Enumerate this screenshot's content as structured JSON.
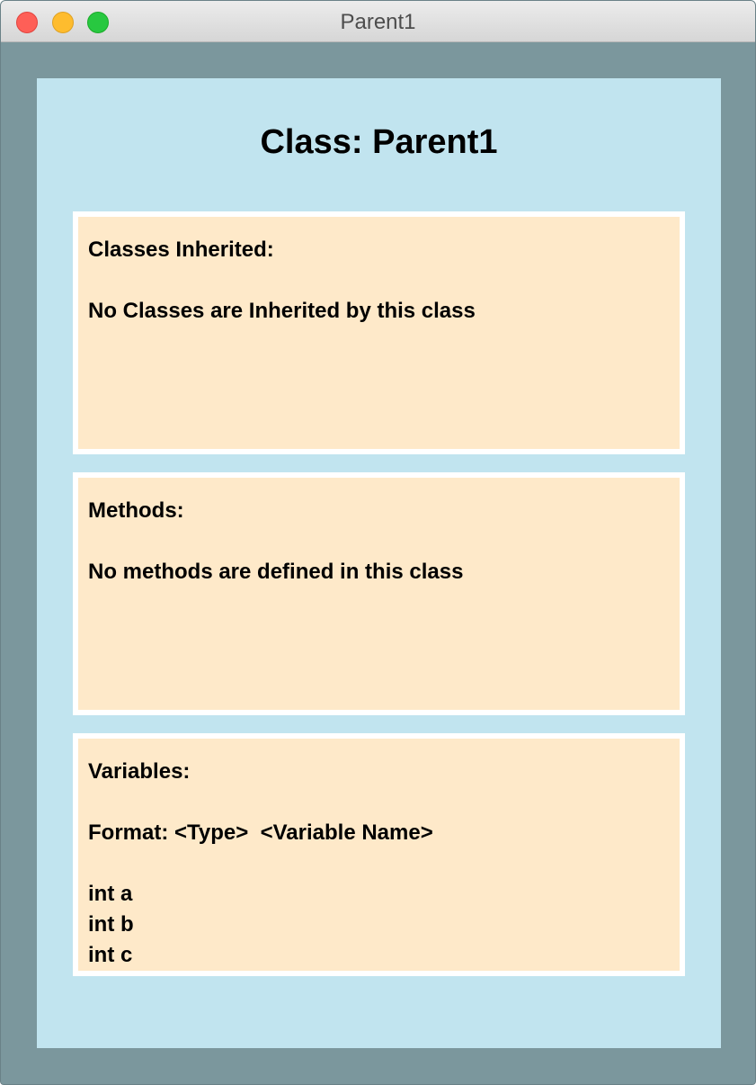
{
  "window": {
    "title": "Parent1"
  },
  "main": {
    "heading": "Class: Parent1",
    "inherited": {
      "label": "Classes Inherited:",
      "text": "No Classes are Inherited by this class"
    },
    "methods": {
      "label": "Methods:",
      "text": "No methods are defined in this class"
    },
    "variables": {
      "label": "Variables:",
      "format": "Format: <Type>  <Variable Name>",
      "items": [
        "int a",
        "int b",
        "int c"
      ]
    }
  },
  "colors": {
    "window_bg": "#7b979d",
    "content_bg": "#c1e4ef",
    "panel_bg": "#fee9c9",
    "panel_border": "#ffffff"
  },
  "icons": {
    "close": "close-icon",
    "minimize": "minimize-icon",
    "zoom": "zoom-icon"
  }
}
